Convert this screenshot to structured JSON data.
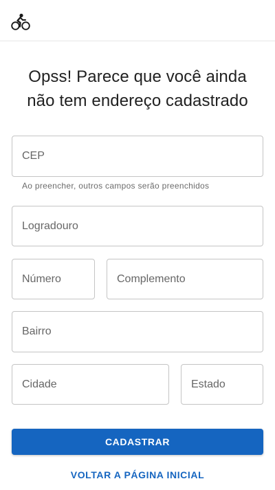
{
  "header": {
    "logo_icon": "bicycle-rider-icon"
  },
  "title": {
    "line1": "Opss! Parece que você ainda",
    "line2": "não tem endereço cadastrado"
  },
  "form": {
    "cep": {
      "placeholder": "CEP",
      "value": ""
    },
    "cep_helper": "Ao preencher, outros campos serão preenchidos",
    "logradouro": {
      "placeholder": "Logradouro",
      "value": ""
    },
    "numero": {
      "placeholder": "Número",
      "value": ""
    },
    "complemento": {
      "placeholder": "Complemento",
      "value": ""
    },
    "bairro": {
      "placeholder": "Bairro",
      "value": ""
    },
    "cidade": {
      "placeholder": "Cidade",
      "value": ""
    },
    "estado": {
      "placeholder": "Estado",
      "value": ""
    }
  },
  "actions": {
    "submit_label": "CADASTRAR",
    "back_label": "VOLTAR A PÁGINA INICIAL"
  },
  "colors": {
    "primary": "#1565c0",
    "border": "#c4c4c4",
    "text": "#212121"
  }
}
